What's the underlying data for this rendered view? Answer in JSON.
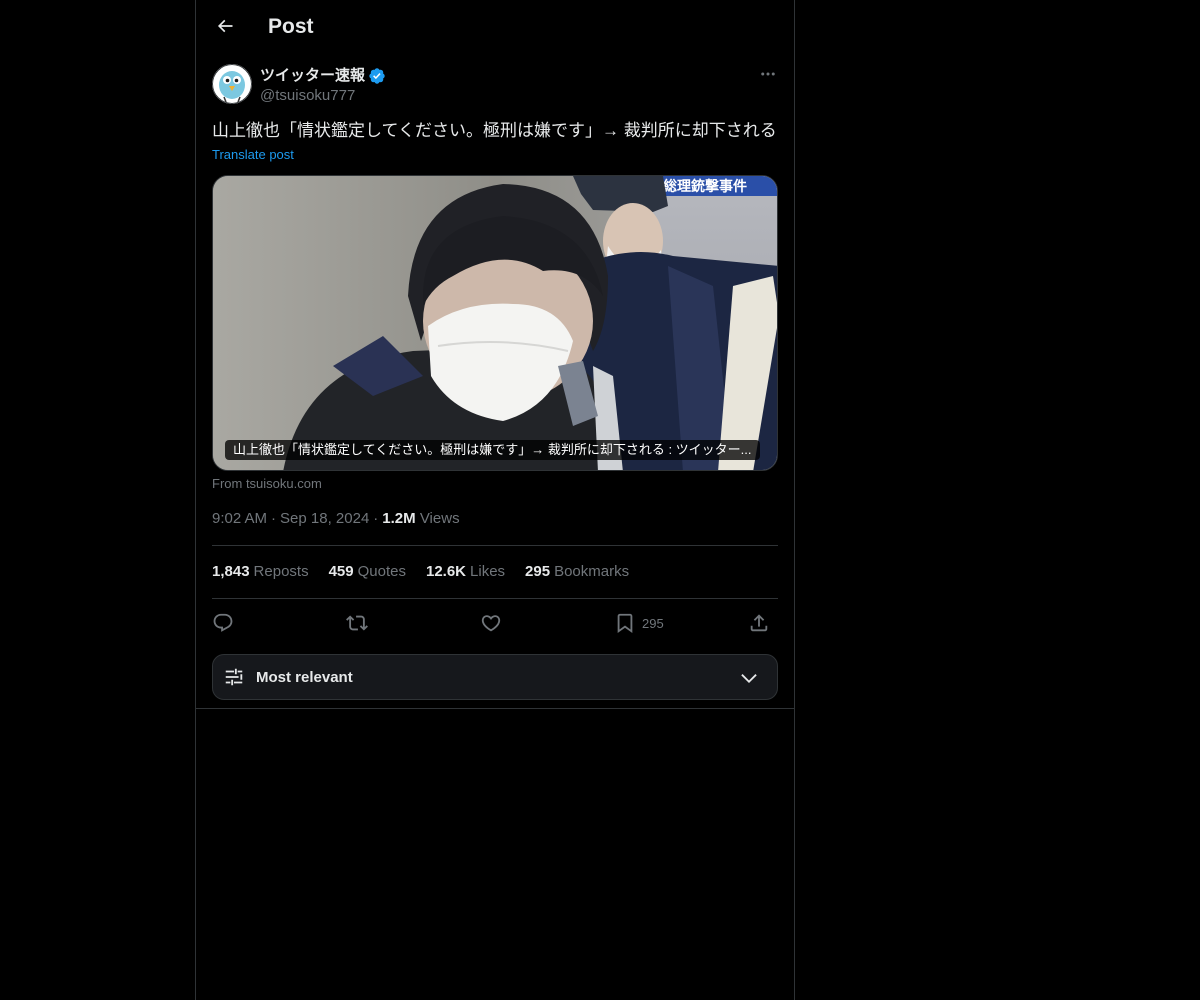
{
  "header": {
    "title": "Post",
    "back_icon": "arrow-left-icon"
  },
  "author": {
    "display_name": "ツイッター速報",
    "handle": "@tsuisoku777",
    "verified": true,
    "verified_color": "#1d9bf0"
  },
  "post": {
    "text": "山上徹也「情状鑑定してください。極刑は嫌です」→ 裁判所に却下される",
    "translate_label": "Translate post",
    "card": {
      "caption": "山上徹也「情状鑑定してください。極刑は嫌です」→ 裁判所に却下される : ツイッター...",
      "source_label": "From tsuisoku.com",
      "banner_text": "安倍元総理銃撃事件"
    },
    "time": "9:02 AM",
    "date": "Sep 18, 2024",
    "views_count": "1.2M",
    "views_label": "Views"
  },
  "stats": {
    "reposts_count": "1,843",
    "reposts_label": "Reposts",
    "quotes_count": "459",
    "quotes_label": "Quotes",
    "likes_count": "12.6K",
    "likes_label": "Likes",
    "bookmarks_count": "295",
    "bookmarks_label": "Bookmarks"
  },
  "actions": {
    "reply_icon": "reply-icon",
    "repost_icon": "repost-icon",
    "like_icon": "heart-icon",
    "bookmark_icon": "bookmark-icon",
    "bookmark_count": "295",
    "share_icon": "share-icon"
  },
  "sort": {
    "label": "Most relevant",
    "icon": "sliders-icon",
    "chevron": "chevron-down-icon"
  },
  "colors": {
    "background": "#000000",
    "text": "#e7e9ea",
    "muted": "#71767b",
    "accent": "#1d9bf0",
    "border": "#2f3336"
  }
}
